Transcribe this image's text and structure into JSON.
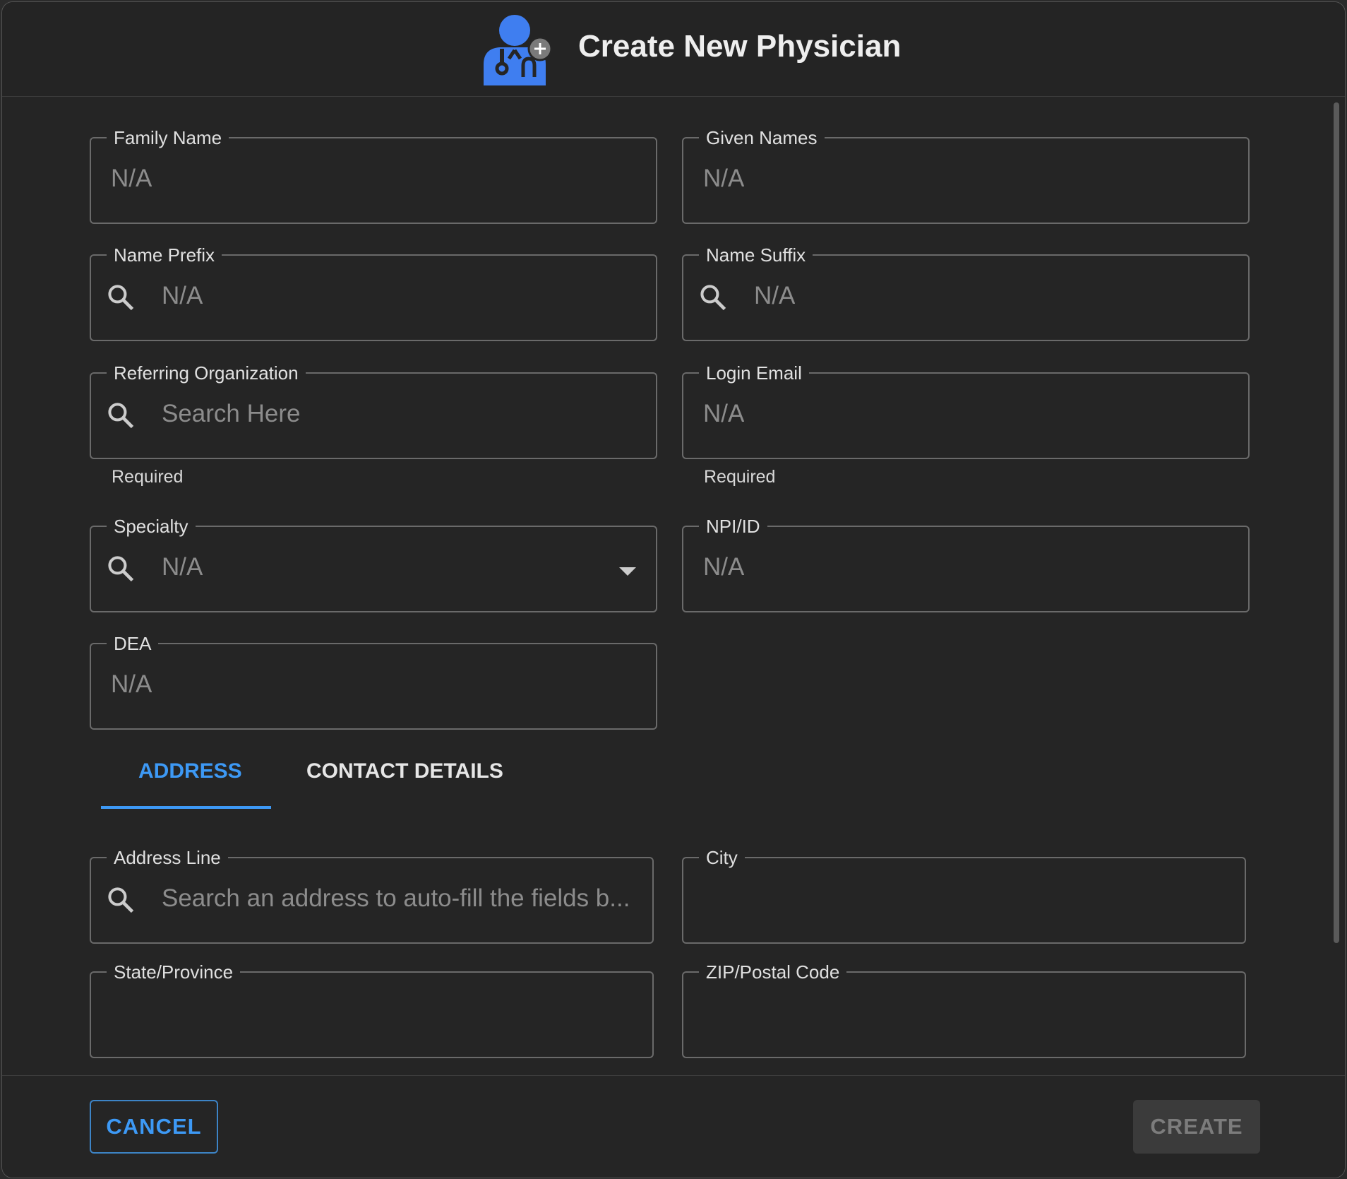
{
  "dialog": {
    "title": "Create New Physician",
    "icon": "physician-add-icon"
  },
  "fields": {
    "family_name": {
      "label": "Family Name",
      "value": "N/A"
    },
    "given_names": {
      "label": "Given Names",
      "value": "N/A"
    },
    "name_prefix": {
      "label": "Name Prefix",
      "value": "N/A",
      "icon": "search-icon"
    },
    "name_suffix": {
      "label": "Name Suffix",
      "value": "N/A",
      "icon": "search-icon"
    },
    "referring_org": {
      "label": "Referring Organization",
      "placeholder": "Search Here",
      "icon": "search-icon",
      "helper": "Required"
    },
    "login_email": {
      "label": "Login Email",
      "value": "N/A",
      "helper": "Required"
    },
    "specialty": {
      "label": "Specialty",
      "value": "N/A",
      "icon": "search-icon"
    },
    "npi_id": {
      "label": "NPI/ID",
      "value": "N/A"
    },
    "dea": {
      "label": "DEA",
      "value": "N/A"
    }
  },
  "tabs": [
    {
      "label": "ADDRESS",
      "active": true
    },
    {
      "label": "CONTACT DETAILS",
      "active": false
    }
  ],
  "address": {
    "address_line": {
      "label": "Address Line",
      "placeholder": "Search an address to auto-fill the fields b...",
      "icon": "search-icon"
    },
    "city": {
      "label": "City",
      "value": ""
    },
    "state": {
      "label": "State/Province",
      "value": ""
    },
    "zip": {
      "label": "ZIP/Postal Code",
      "value": ""
    }
  },
  "footer": {
    "cancel_label": "CANCEL",
    "create_label": "CREATE"
  },
  "colors": {
    "accent": "#3d99f5",
    "icon_blue": "#3f7ef0",
    "background": "#252525"
  }
}
